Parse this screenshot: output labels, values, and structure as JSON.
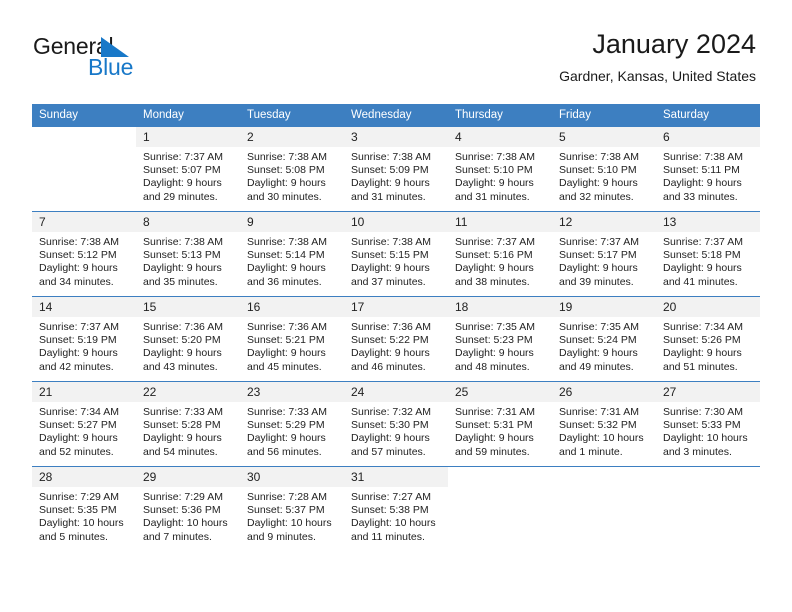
{
  "brand": {
    "line1": "General",
    "line2": "Blue",
    "mark": "triangle-logo",
    "blue": "#1878c8"
  },
  "header": {
    "title": "January 2024",
    "subtitle": "Gardner, Kansas, United States"
  },
  "theme": {
    "header_blue": "#3d7fc1",
    "daynum_bg": "#f2f2f2"
  },
  "weekdays": [
    "Sunday",
    "Monday",
    "Tuesday",
    "Wednesday",
    "Thursday",
    "Friday",
    "Saturday"
  ],
  "weeks": [
    [
      {
        "day": "",
        "sunrise": "",
        "sunset": "",
        "daylight1": "",
        "daylight2": ""
      },
      {
        "day": "1",
        "sunrise": "Sunrise: 7:37 AM",
        "sunset": "Sunset: 5:07 PM",
        "daylight1": "Daylight: 9 hours",
        "daylight2": "and 29 minutes."
      },
      {
        "day": "2",
        "sunrise": "Sunrise: 7:38 AM",
        "sunset": "Sunset: 5:08 PM",
        "daylight1": "Daylight: 9 hours",
        "daylight2": "and 30 minutes."
      },
      {
        "day": "3",
        "sunrise": "Sunrise: 7:38 AM",
        "sunset": "Sunset: 5:09 PM",
        "daylight1": "Daylight: 9 hours",
        "daylight2": "and 31 minutes."
      },
      {
        "day": "4",
        "sunrise": "Sunrise: 7:38 AM",
        "sunset": "Sunset: 5:10 PM",
        "daylight1": "Daylight: 9 hours",
        "daylight2": "and 31 minutes."
      },
      {
        "day": "5",
        "sunrise": "Sunrise: 7:38 AM",
        "sunset": "Sunset: 5:10 PM",
        "daylight1": "Daylight: 9 hours",
        "daylight2": "and 32 minutes."
      },
      {
        "day": "6",
        "sunrise": "Sunrise: 7:38 AM",
        "sunset": "Sunset: 5:11 PM",
        "daylight1": "Daylight: 9 hours",
        "daylight2": "and 33 minutes."
      }
    ],
    [
      {
        "day": "7",
        "sunrise": "Sunrise: 7:38 AM",
        "sunset": "Sunset: 5:12 PM",
        "daylight1": "Daylight: 9 hours",
        "daylight2": "and 34 minutes."
      },
      {
        "day": "8",
        "sunrise": "Sunrise: 7:38 AM",
        "sunset": "Sunset: 5:13 PM",
        "daylight1": "Daylight: 9 hours",
        "daylight2": "and 35 minutes."
      },
      {
        "day": "9",
        "sunrise": "Sunrise: 7:38 AM",
        "sunset": "Sunset: 5:14 PM",
        "daylight1": "Daylight: 9 hours",
        "daylight2": "and 36 minutes."
      },
      {
        "day": "10",
        "sunrise": "Sunrise: 7:38 AM",
        "sunset": "Sunset: 5:15 PM",
        "daylight1": "Daylight: 9 hours",
        "daylight2": "and 37 minutes."
      },
      {
        "day": "11",
        "sunrise": "Sunrise: 7:37 AM",
        "sunset": "Sunset: 5:16 PM",
        "daylight1": "Daylight: 9 hours",
        "daylight2": "and 38 minutes."
      },
      {
        "day": "12",
        "sunrise": "Sunrise: 7:37 AM",
        "sunset": "Sunset: 5:17 PM",
        "daylight1": "Daylight: 9 hours",
        "daylight2": "and 39 minutes."
      },
      {
        "day": "13",
        "sunrise": "Sunrise: 7:37 AM",
        "sunset": "Sunset: 5:18 PM",
        "daylight1": "Daylight: 9 hours",
        "daylight2": "and 41 minutes."
      }
    ],
    [
      {
        "day": "14",
        "sunrise": "Sunrise: 7:37 AM",
        "sunset": "Sunset: 5:19 PM",
        "daylight1": "Daylight: 9 hours",
        "daylight2": "and 42 minutes."
      },
      {
        "day": "15",
        "sunrise": "Sunrise: 7:36 AM",
        "sunset": "Sunset: 5:20 PM",
        "daylight1": "Daylight: 9 hours",
        "daylight2": "and 43 minutes."
      },
      {
        "day": "16",
        "sunrise": "Sunrise: 7:36 AM",
        "sunset": "Sunset: 5:21 PM",
        "daylight1": "Daylight: 9 hours",
        "daylight2": "and 45 minutes."
      },
      {
        "day": "17",
        "sunrise": "Sunrise: 7:36 AM",
        "sunset": "Sunset: 5:22 PM",
        "daylight1": "Daylight: 9 hours",
        "daylight2": "and 46 minutes."
      },
      {
        "day": "18",
        "sunrise": "Sunrise: 7:35 AM",
        "sunset": "Sunset: 5:23 PM",
        "daylight1": "Daylight: 9 hours",
        "daylight2": "and 48 minutes."
      },
      {
        "day": "19",
        "sunrise": "Sunrise: 7:35 AM",
        "sunset": "Sunset: 5:24 PM",
        "daylight1": "Daylight: 9 hours",
        "daylight2": "and 49 minutes."
      },
      {
        "day": "20",
        "sunrise": "Sunrise: 7:34 AM",
        "sunset": "Sunset: 5:26 PM",
        "daylight1": "Daylight: 9 hours",
        "daylight2": "and 51 minutes."
      }
    ],
    [
      {
        "day": "21",
        "sunrise": "Sunrise: 7:34 AM",
        "sunset": "Sunset: 5:27 PM",
        "daylight1": "Daylight: 9 hours",
        "daylight2": "and 52 minutes."
      },
      {
        "day": "22",
        "sunrise": "Sunrise: 7:33 AM",
        "sunset": "Sunset: 5:28 PM",
        "daylight1": "Daylight: 9 hours",
        "daylight2": "and 54 minutes."
      },
      {
        "day": "23",
        "sunrise": "Sunrise: 7:33 AM",
        "sunset": "Sunset: 5:29 PM",
        "daylight1": "Daylight: 9 hours",
        "daylight2": "and 56 minutes."
      },
      {
        "day": "24",
        "sunrise": "Sunrise: 7:32 AM",
        "sunset": "Sunset: 5:30 PM",
        "daylight1": "Daylight: 9 hours",
        "daylight2": "and 57 minutes."
      },
      {
        "day": "25",
        "sunrise": "Sunrise: 7:31 AM",
        "sunset": "Sunset: 5:31 PM",
        "daylight1": "Daylight: 9 hours",
        "daylight2": "and 59 minutes."
      },
      {
        "day": "26",
        "sunrise": "Sunrise: 7:31 AM",
        "sunset": "Sunset: 5:32 PM",
        "daylight1": "Daylight: 10 hours",
        "daylight2": "and 1 minute."
      },
      {
        "day": "27",
        "sunrise": "Sunrise: 7:30 AM",
        "sunset": "Sunset: 5:33 PM",
        "daylight1": "Daylight: 10 hours",
        "daylight2": "and 3 minutes."
      }
    ],
    [
      {
        "day": "28",
        "sunrise": "Sunrise: 7:29 AM",
        "sunset": "Sunset: 5:35 PM",
        "daylight1": "Daylight: 10 hours",
        "daylight2": "and 5 minutes."
      },
      {
        "day": "29",
        "sunrise": "Sunrise: 7:29 AM",
        "sunset": "Sunset: 5:36 PM",
        "daylight1": "Daylight: 10 hours",
        "daylight2": "and 7 minutes."
      },
      {
        "day": "30",
        "sunrise": "Sunrise: 7:28 AM",
        "sunset": "Sunset: 5:37 PM",
        "daylight1": "Daylight: 10 hours",
        "daylight2": "and 9 minutes."
      },
      {
        "day": "31",
        "sunrise": "Sunrise: 7:27 AM",
        "sunset": "Sunset: 5:38 PM",
        "daylight1": "Daylight: 10 hours",
        "daylight2": "and 11 minutes."
      },
      {
        "day": "",
        "sunrise": "",
        "sunset": "",
        "daylight1": "",
        "daylight2": ""
      },
      {
        "day": "",
        "sunrise": "",
        "sunset": "",
        "daylight1": "",
        "daylight2": ""
      },
      {
        "day": "",
        "sunrise": "",
        "sunset": "",
        "daylight1": "",
        "daylight2": ""
      }
    ]
  ]
}
